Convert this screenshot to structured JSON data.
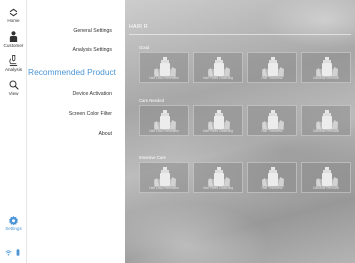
{
  "rail": {
    "items": [
      {
        "icon": "home-icon",
        "label": "Home"
      },
      {
        "icon": "customer-icon",
        "label": "Customer"
      },
      {
        "icon": "analysis-icon",
        "label": "Analysis"
      },
      {
        "icon": "view-icon",
        "label": "View"
      },
      {
        "icon": "settings-icon",
        "label": "Settings"
      }
    ],
    "status_icons": [
      "wifi-icon",
      "battery-icon"
    ],
    "accent": "#4b95d6"
  },
  "menu": {
    "items": [
      {
        "label": "General Settings",
        "active": false
      },
      {
        "label": "Analysis Settings",
        "active": false
      },
      {
        "label": "Recommended Product",
        "active": true
      },
      {
        "label": "Device Activation",
        "active": false
      },
      {
        "label": "Screen Color Filter",
        "active": false
      },
      {
        "label": "About",
        "active": false
      }
    ]
  },
  "main": {
    "title": "HAIR R",
    "sections": [
      {
        "label": "Good",
        "cards": [
          "Hair Loss Prevention",
          "Hair Pores Cleansing",
          "Hair Thickness",
          "Dandruff Removal"
        ]
      },
      {
        "label": "Care Needed",
        "cards": [
          "Hair Loss Prevention",
          "Hair Pores Cleansing",
          "Hair Thickness",
          "Dandruff Removal"
        ]
      },
      {
        "label": "Intensive Care",
        "cards": [
          "Hair Loss Prevention",
          "Hair Pores Cleansing",
          "Hair Thickness",
          "Dandruff Removal"
        ]
      }
    ]
  }
}
